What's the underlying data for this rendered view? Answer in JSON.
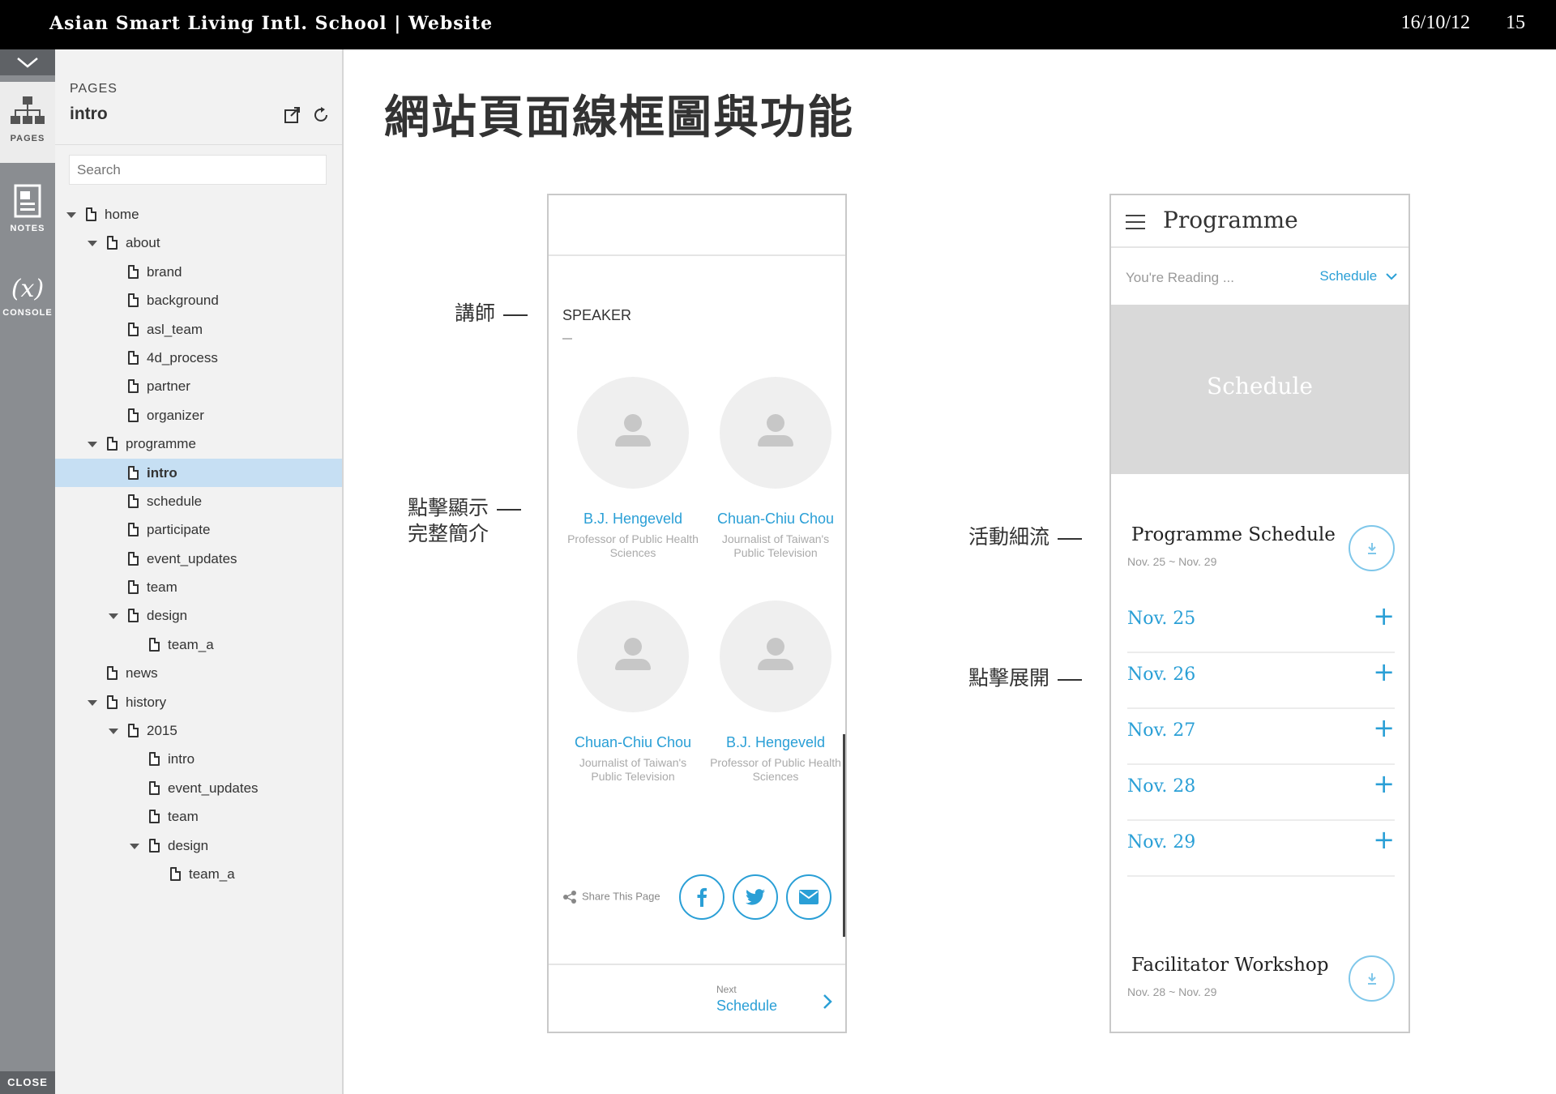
{
  "topbar": {
    "title": "Asian Smart Living Intl. School | Website",
    "date": "16/10/12",
    "page_number": "15"
  },
  "rail": {
    "pages_label": "PAGES",
    "notes_label": "NOTES",
    "console_label": "CONSOLE",
    "console_symbol": "(x)",
    "close_label": "CLOSE"
  },
  "panel": {
    "caption": "PAGES",
    "current_page": "intro",
    "search_placeholder": "Search",
    "tree": [
      {
        "label": "home",
        "depth": 0,
        "expanded": true
      },
      {
        "label": "about",
        "depth": 1,
        "expanded": true
      },
      {
        "label": "brand",
        "depth": 2
      },
      {
        "label": "background",
        "depth": 2
      },
      {
        "label": "asl_team",
        "depth": 2
      },
      {
        "label": "4d_process",
        "depth": 2
      },
      {
        "label": "partner",
        "depth": 2
      },
      {
        "label": "organizer",
        "depth": 2
      },
      {
        "label": "programme",
        "depth": 1,
        "expanded": true
      },
      {
        "label": "intro",
        "depth": 2,
        "selected": true
      },
      {
        "label": "schedule",
        "depth": 2
      },
      {
        "label": "participate",
        "depth": 2
      },
      {
        "label": "event_updates",
        "depth": 2
      },
      {
        "label": "team",
        "depth": 2
      },
      {
        "label": "design",
        "depth": 2,
        "expanded": true
      },
      {
        "label": "team_a",
        "depth": 3
      },
      {
        "label": "news",
        "depth": 1
      },
      {
        "label": "history",
        "depth": 1,
        "expanded": true
      },
      {
        "label": "2015",
        "depth": 2,
        "expanded": true
      },
      {
        "label": "intro",
        "depth": 3
      },
      {
        "label": "event_updates",
        "depth": 3
      },
      {
        "label": "team",
        "depth": 3
      },
      {
        "label": "design",
        "depth": 3,
        "expanded": true
      },
      {
        "label": "team_a",
        "depth": 4
      }
    ]
  },
  "slide": {
    "title": "網站頁面線框圖與功能",
    "annotations": {
      "speaker": "講師",
      "click_bio_line1": "點擊顯示",
      "click_bio_line2": "完整簡介",
      "schedule_detail": "活動細流",
      "click_expand": "點擊展開"
    }
  },
  "wireframe_speaker": {
    "heading": "SPEAKER",
    "speakers": [
      {
        "name": "B.J. Hengeveld",
        "role": "Professor of Public Health Sciences"
      },
      {
        "name": "Chuan-Chiu Chou",
        "role": "Journalist of Taiwan's Public Television"
      },
      {
        "name": "Chuan-Chiu Chou",
        "role": "Journalist of Taiwan's Public Television"
      },
      {
        "name": "B.J. Hengeveld",
        "role": "Professor of Public Health Sciences"
      }
    ],
    "share_label": "Share This Page",
    "social": [
      "facebook-icon",
      "twitter-icon",
      "mail-icon"
    ],
    "next_label": "Next",
    "next_value": "Schedule"
  },
  "wireframe_programme": {
    "header_title": "Programme",
    "reading_label": "You're Reading ...",
    "reading_value": "Schedule",
    "banner_text": "Schedule",
    "section1_title": "Programme Schedule",
    "section1_dates": "Nov. 25 ~ Nov. 29",
    "days": [
      "Nov. 25",
      "Nov. 26",
      "Nov. 27",
      "Nov. 28",
      "Nov. 29"
    ],
    "section2_title": "Facilitator Workshop",
    "section2_dates": "Nov. 28 ~ Nov. 29",
    "accent_color": "#2a9fd6"
  }
}
